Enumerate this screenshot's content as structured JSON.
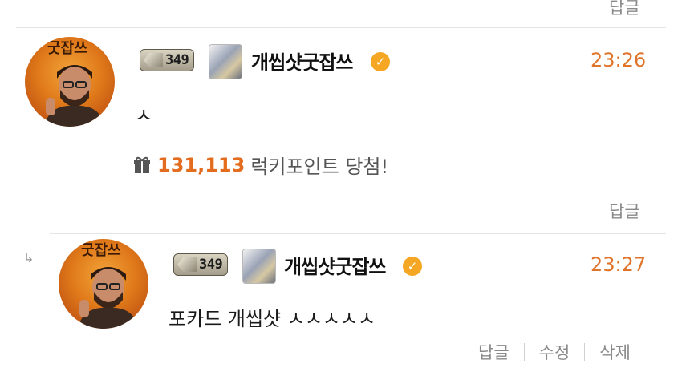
{
  "top_reply_label": "답글",
  "comments": [
    {
      "avatar_text": "굿잡쓰",
      "level": "349",
      "nickname": "개씹샷굿잡쓰",
      "verified_icon": "check-icon",
      "time": "23:26",
      "text": "ㅅ",
      "lucky": {
        "points": "131,113",
        "text": "럭키포인트 당첨!"
      },
      "reply_label": "답글"
    },
    {
      "avatar_text": "굿잡쓰",
      "level": "349",
      "nickname": "개씹샷굿잡쓰",
      "verified_icon": "check-icon",
      "time": "23:27",
      "text": "포카드 개씹샷 ㅅㅅㅅㅅㅅ",
      "actions": [
        "답글",
        "수정",
        "삭제"
      ]
    }
  ],
  "colors": {
    "accent": "#e46c1f",
    "time": "#e0742a",
    "verified": "#f5a623"
  }
}
